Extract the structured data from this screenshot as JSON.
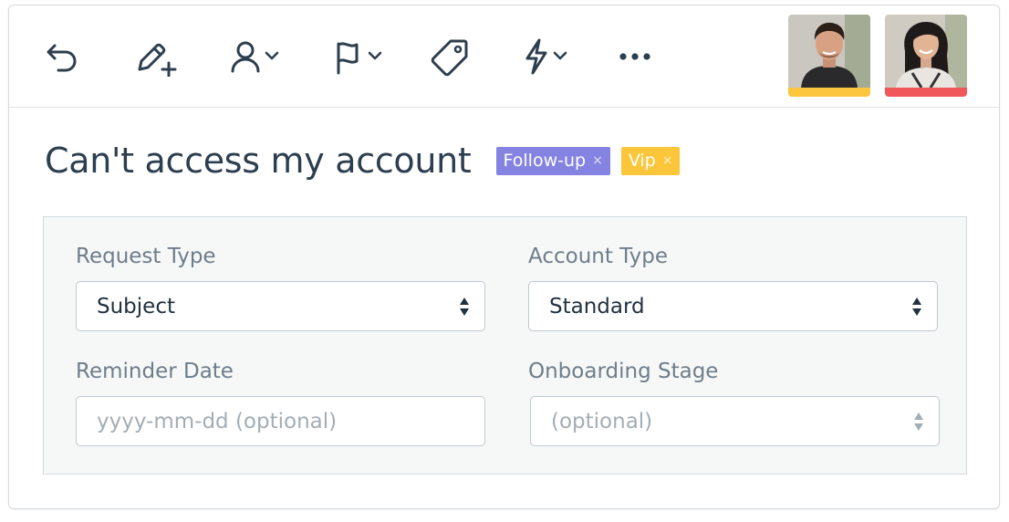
{
  "toolbar": {
    "buttons": [
      {
        "name": "undo-icon"
      },
      {
        "name": "edit-add-icon"
      },
      {
        "name": "assign-user-icon",
        "dropdown": true
      },
      {
        "name": "flag-icon",
        "dropdown": true
      },
      {
        "name": "tag-icon"
      },
      {
        "name": "lightning-icon",
        "dropdown": true
      },
      {
        "name": "more-icon"
      }
    ],
    "avatars": [
      {
        "name": "avatar-agent-1",
        "status_color": "#fcc73f"
      },
      {
        "name": "avatar-agent-2",
        "status_color": "#f0575a"
      }
    ]
  },
  "ticket": {
    "title": "Can't access my account",
    "tags": [
      {
        "label": "Follow-up",
        "remove": "×",
        "color": "#8583e2"
      },
      {
        "label": "Vip",
        "remove": "×",
        "color": "#fcc63b"
      }
    ]
  },
  "form": {
    "request_type": {
      "label": "Request Type",
      "value": "Subject"
    },
    "account_type": {
      "label": "Account Type",
      "value": "Standard"
    },
    "reminder_date": {
      "label": "Reminder Date",
      "placeholder": "yyyy-mm-dd (optional)"
    },
    "onboarding_stage": {
      "label": "Onboarding Stage",
      "placeholder": "(optional)"
    }
  }
}
